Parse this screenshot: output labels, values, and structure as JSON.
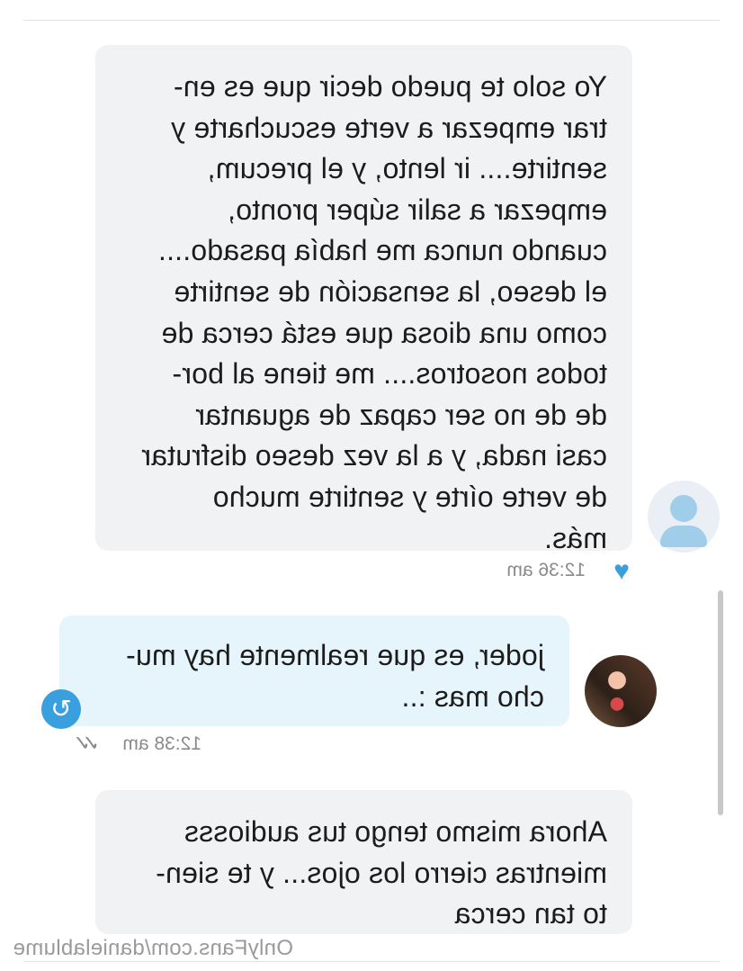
{
  "messages": [
    {
      "lines": [
        "Yo solo te puedo decir que es en-",
        "trar empezar a verte escucharte y",
        "sentirte.... ir lento, y el precum,",
        "empezar a salir súper pronto,",
        "cuando nunca me había pasado....",
        "el deseo, la sensación de sentirte",
        "como una diosa que está cerca de",
        "todos nosotros.... me tiene al bor-",
        "de de no ser capaz de aguantar",
        "casi nada, y a la vez deseo disfrutar",
        "de verte oírte y sentirte mucho",
        "más."
      ],
      "time": "12:36 am"
    },
    {
      "lines": [
        "joder, es que realmente hay mu-",
        "cho mas :.."
      ],
      "time": "12:38 am"
    },
    {
      "lines": [
        "Ahora mismo tengo tus audiosss",
        "mientras cierro los ojos... y te sien-",
        "to tan cerca"
      ]
    }
  ],
  "watermark": "OnlyFans.com/danielablume",
  "icons": {
    "liked": "heart-icon",
    "read": "double-check-icon",
    "scroll": "refresh-icon",
    "avatar_placeholder": "user-avatar-icon"
  },
  "colors": {
    "incoming_bubble": "#f1f2f3",
    "outgoing_bubble": "#e6f4fb",
    "accent": "#3a9fdf"
  }
}
